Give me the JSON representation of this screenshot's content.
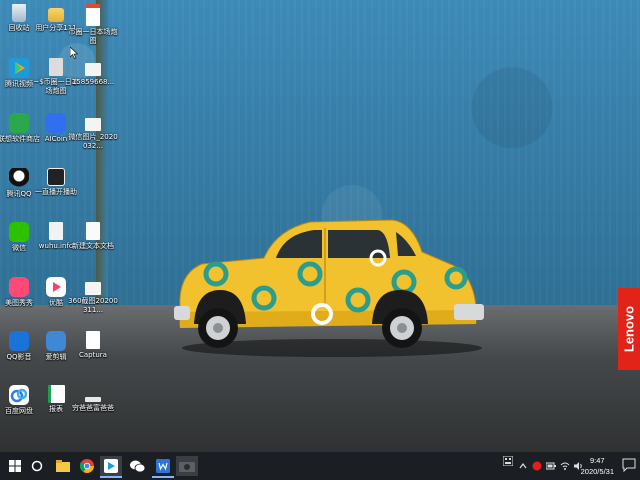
{
  "desktop": {
    "brand": "Lenovo",
    "icons": [
      {
        "label": "回收站",
        "icon": "recycle-bin-icon"
      },
      {
        "label": "用户分享111",
        "icon": "folder-icon"
      },
      {
        "label": "币圈一日本场炮图",
        "icon": "pdf-doc-icon"
      },
      {
        "label": "腾讯视频",
        "icon": "tencent-video-icon"
      },
      {
        "label": "~$币圈一日本场炮图",
        "icon": "doc-icon"
      },
      {
        "label": "15859668...",
        "icon": "image-file-icon"
      },
      {
        "label": "联想软件商店",
        "icon": "lenovo-store-icon"
      },
      {
        "label": "AICoin",
        "icon": "aicoin-icon"
      },
      {
        "label": "微信图片_2020032...",
        "icon": "image-file-icon"
      },
      {
        "label": "腾讯QQ",
        "icon": "qq-icon"
      },
      {
        "label": "一直播开播助",
        "icon": "yizhibo-icon"
      },
      {
        "label": "微信",
        "icon": "wechat-icon"
      },
      {
        "label": "wuhu.info",
        "icon": "file-icon"
      },
      {
        "label": "新建文本文档",
        "icon": "text-file-icon"
      },
      {
        "label": "美图秀秀",
        "icon": "meitu-icon"
      },
      {
        "label": "优酷",
        "icon": "youku-icon"
      },
      {
        "label": "360截图20200311...",
        "icon": "image-file-icon"
      },
      {
        "label": "QQ影音",
        "icon": "qq-player-icon"
      },
      {
        "label": "爱剪辑",
        "icon": "aijianji-icon"
      },
      {
        "label": "Captura",
        "icon": "captura-icon"
      },
      {
        "label": "百度网盘",
        "icon": "baidu-netdisk-icon"
      },
      {
        "label": "报表",
        "icon": "spreadsheet-icon"
      },
      {
        "label": "穷爸爸富爸爸",
        "icon": "doc-icon"
      }
    ]
  },
  "taskbar": {
    "time": "9:47",
    "date": "2020/5/31",
    "pinned": [
      "start-icon",
      "cortana-icon",
      "file-explorer-icon",
      "chrome-icon",
      "tencent-video-taskbar-icon",
      "wechat-taskbar-icon",
      "word-icon",
      "camera-icon"
    ]
  },
  "colors": {
    "taskbar_bg": "#1b1e22",
    "lenovo_red": "#e2231a",
    "car_yellow": "#f2c12e",
    "car_teal": "#2a9d8f"
  }
}
